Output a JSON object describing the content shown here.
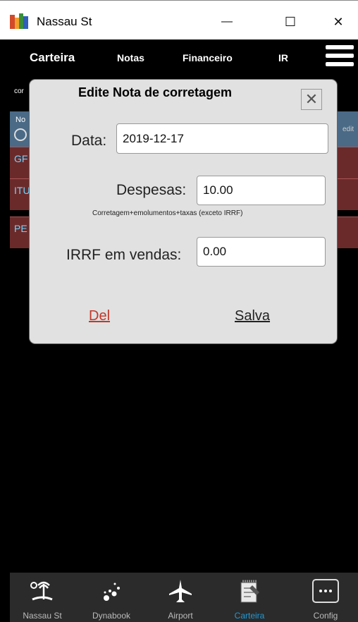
{
  "window": {
    "title": "Nassau St",
    "minimize_glyph": "—",
    "maximize_glyph": "☐",
    "close_glyph": "✕"
  },
  "nav": {
    "tabs": [
      "Carteira",
      "Notas",
      "Financeiro",
      "IR"
    ]
  },
  "background": {
    "left_label": "cor",
    "header_abbrev": "No",
    "edit_label": "edit",
    "rows": [
      "GF",
      "ITU",
      "PE"
    ]
  },
  "dialog": {
    "title": "Edite Nota de corretagem",
    "close_glyph": "✕",
    "data_label": "Data:",
    "data_value": "2019-12-17",
    "despesas_label": "Despesas:",
    "despesas_value": "10.00",
    "despesas_hint": "Corretagem+emolumentos+taxas (exceto IRRF)",
    "irrf_label": "IRRF em vendas:",
    "irrf_value": "0.00",
    "del_label": "Del",
    "salva_label": "Salva"
  },
  "bottom_nav": {
    "items": [
      {
        "label": "Nassau St",
        "icon": "island-icon"
      },
      {
        "label": "Dynabook",
        "icon": "dots-icon"
      },
      {
        "label": "Airport",
        "icon": "airplane-icon"
      },
      {
        "label": "Carteira",
        "icon": "notepad-icon",
        "active": true
      },
      {
        "label": "Config",
        "icon": "more-icon"
      }
    ]
  },
  "colors": {
    "accent": "#1e9ad6",
    "row_bg": "#6b2a2a",
    "row_text": "#6fd5ff",
    "del": "#c0392b"
  }
}
